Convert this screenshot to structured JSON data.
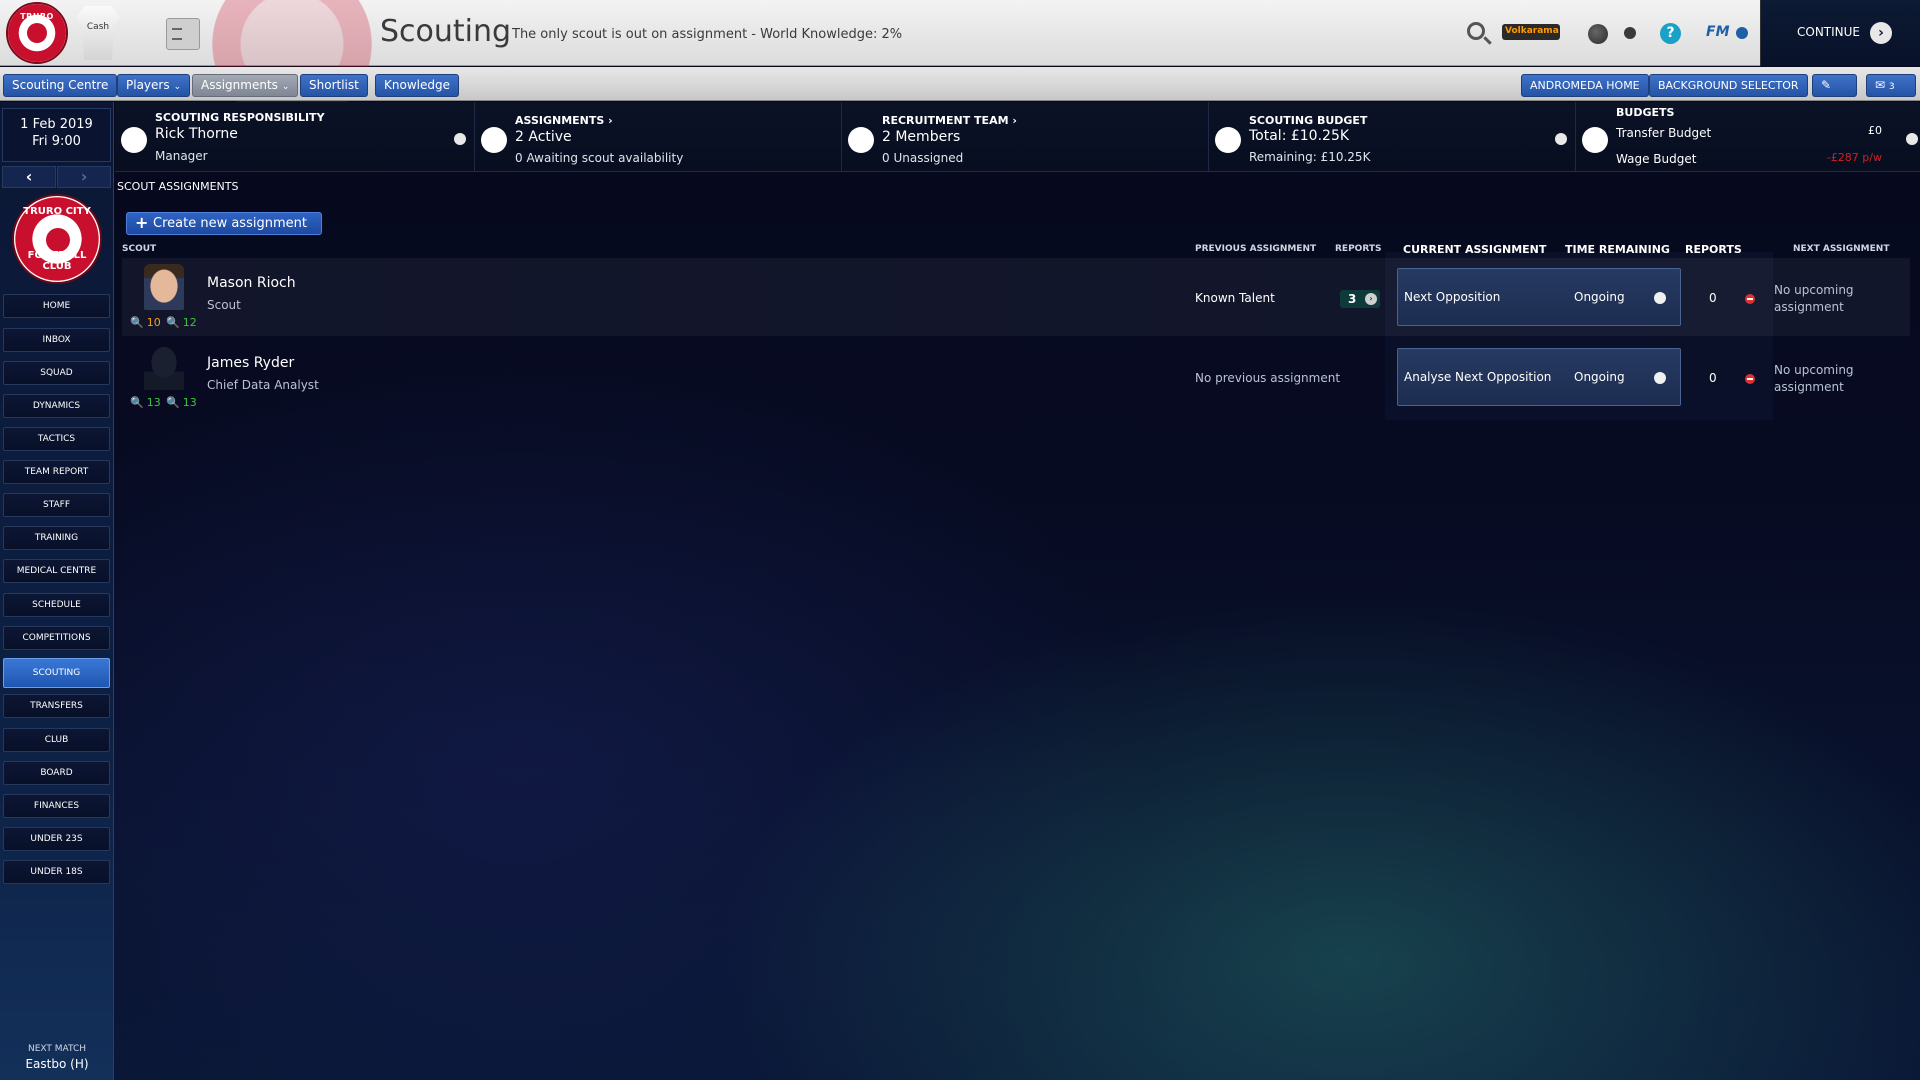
{
  "header": {
    "title": "Scouting",
    "subtitle": "The only scout is out on assignment - World Knowledge: 2%",
    "club_crest_text": "TRURO CITY",
    "shirt_sponsor": "Cash",
    "brand_logo": "Volkarama",
    "help_label": "?",
    "fm_label": "FM",
    "continue_label": "CONTINUE",
    "continue_arrow": "›"
  },
  "toolbar": {
    "tabs": [
      {
        "label": "Scouting Centre",
        "style": "blue"
      },
      {
        "label": "Players",
        "style": "blue",
        "dropdown": true
      },
      {
        "label": "Assignments",
        "style": "grey",
        "dropdown": true
      },
      {
        "label": "Shortlist",
        "style": "blue"
      },
      {
        "label": "Knowledge",
        "style": "blue"
      }
    ],
    "dropdown_glyph": "⌄",
    "right_buttons": {
      "andromeda_home": "ANDROMEDA HOME",
      "background_selector": "BACKGROUND SELECTOR",
      "messages_count": "3"
    }
  },
  "sidebar": {
    "date": "1 Feb 2019",
    "time": "Fri 9:00",
    "back_glyph": "‹",
    "forward_glyph": "›",
    "crest_top": "TRURO CITY",
    "crest_bottom": "FOOTBALL CLUB",
    "items": [
      {
        "label": "HOME"
      },
      {
        "label": "INBOX"
      },
      {
        "label": "SQUAD"
      },
      {
        "label": "DYNAMICS"
      },
      {
        "label": "TACTICS"
      },
      {
        "label": "TEAM REPORT"
      },
      {
        "label": "STAFF"
      },
      {
        "label": "TRAINING"
      },
      {
        "label": "MEDICAL CENTRE"
      },
      {
        "label": "SCHEDULE"
      },
      {
        "label": "COMPETITIONS"
      },
      {
        "label": "SCOUTING",
        "active": true
      },
      {
        "label": "TRANSFERS"
      },
      {
        "label": "CLUB"
      },
      {
        "label": "BOARD"
      },
      {
        "label": "FINANCES"
      },
      {
        "label": "UNDER 23S"
      },
      {
        "label": "UNDER 18S"
      }
    ],
    "next_match_label": "NEXT MATCH",
    "next_match_value": "Eastbo (H)"
  },
  "info_strip": {
    "responsibility": {
      "header": "SCOUTING RESPONSIBILITY",
      "main": "Rick Thorne",
      "sub": "Manager"
    },
    "assignments": {
      "header": "ASSIGNMENTS ›",
      "main": "2 Active",
      "sub": "0 Awaiting scout availability"
    },
    "recruitment": {
      "header": "RECRUITMENT TEAM ›",
      "main": "2 Members",
      "sub": "0 Unassigned"
    },
    "budget": {
      "header": "SCOUTING BUDGET",
      "main": "Total: £10.25K",
      "sub": "Remaining: £10.25K"
    },
    "budgets": {
      "header": "BUDGETS",
      "transfer_label": "Transfer Budget",
      "transfer_value": "£0",
      "wage_label": "Wage Budget",
      "wage_value": "-£287 p/w"
    }
  },
  "main": {
    "section_title": "SCOUT ASSIGNMENTS",
    "create_button": "Create new assignment",
    "create_plus": "+",
    "columns": {
      "scout": "SCOUT",
      "previous_assignment": "PREVIOUS ASSIGNMENT",
      "reports": "REPORTS",
      "current_assignment": "CURRENT ASSIGNMENT",
      "time_remaining": "TIME REMAINING",
      "current_reports": "REPORTS",
      "next_assignment": "NEXT ASSIGNMENT"
    },
    "scouts": [
      {
        "name": "Mason Rioch",
        "role": "Scout",
        "judging_ability": "10",
        "judging_potential": "12",
        "previous_assignment": "Known Talent",
        "previous_reports": "3",
        "current_assignment": "Next Opposition",
        "time_remaining": "Ongoing",
        "current_reports": "0",
        "next_assignment": "No upcoming assignment"
      },
      {
        "name": "James Ryder",
        "role": "Chief Data Analyst",
        "judging_ability": "13",
        "judging_potential": "13",
        "previous_assignment": "No previous assignment",
        "current_assignment": "Analyse Next Opposition",
        "time_remaining": "Ongoing",
        "current_reports": "0",
        "next_assignment": "No upcoming assignment"
      }
    ]
  },
  "colors": {
    "accent_blue": "#2554a6",
    "rating_orange": "#f0a020",
    "rating_green": "#3cc43c",
    "wage_red": "#d02020",
    "remove_red": "#e03030"
  },
  "icons": {
    "magnifier": "🔍"
  }
}
